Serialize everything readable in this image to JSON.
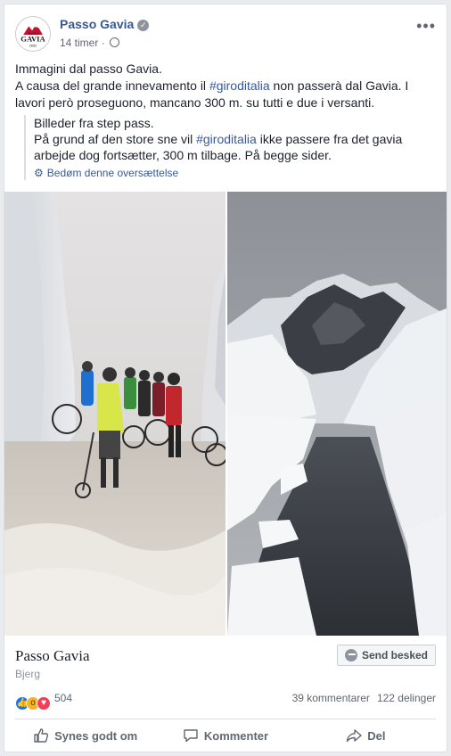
{
  "post": {
    "page_name": "Passo Gavia",
    "time": "14 timer",
    "separator": "·",
    "more_label": "•••",
    "verified_glyph": "✓",
    "text": {
      "line1": "Immagini dal passo Gavia.",
      "line2_a": "A causa del grande innevamento il ",
      "hashtag": "#giroditalia",
      "line2_b": " non passerà dal Gavia. I lavori però proseguono, mancano 300 m. su tutti e due i versanti."
    },
    "translation": {
      "line1": "Billeder fra step pass.",
      "line2_a": "På grund af den store sne vil ",
      "hashtag": "#giroditalia",
      "line2_b": " ikke passere fra det gavia arbejde dog fortsætter, 300 m tilbage. På begge sider.",
      "rate_label": "Bedøm denne oversættelse"
    }
  },
  "logo": {
    "top": "PASSO",
    "main": "GAVIA",
    "bottom": "2652"
  },
  "page_card": {
    "name": "Passo Gavia",
    "category": "Bjerg",
    "send_button": "Send besked"
  },
  "stats": {
    "reaction_count": "504",
    "comments": "39 kommentarer",
    "shares": "122 delinger",
    "reaction_icons": [
      "like-icon",
      "wow-icon",
      "love-icon"
    ]
  },
  "actions": {
    "like": "Synes godt om",
    "comment": "Kommenter",
    "share": "Del"
  },
  "icons": {
    "verified": "verified-badge-icon",
    "audience": "globe-icon",
    "settings": "gear-icon",
    "messenger": "messenger-icon"
  },
  "colors": {
    "link": "#365899",
    "like": "#1877f2",
    "love": "#f33e58",
    "wow": "#f7b125"
  }
}
